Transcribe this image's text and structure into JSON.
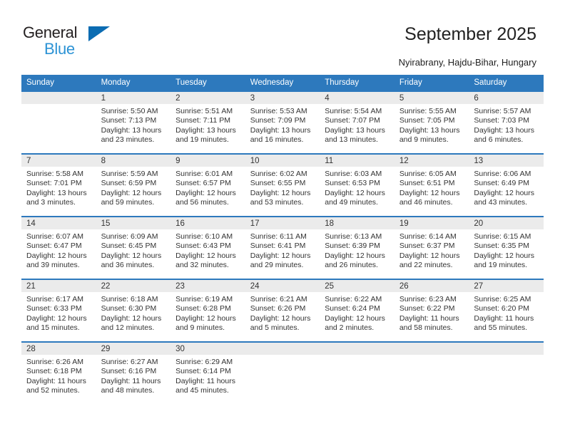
{
  "brand": {
    "name_part1": "General",
    "name_part2": "Blue",
    "triangle_color": "#0b6cb2",
    "blue_color": "#2c93d5"
  },
  "header": {
    "title": "September 2025",
    "subtitle": "Nyirabrany, Hajdu-Bihar, Hungary",
    "accent_color": "#2d79bd"
  },
  "calendar": {
    "weekday_headers": [
      "Sunday",
      "Monday",
      "Tuesday",
      "Wednesday",
      "Thursday",
      "Friday",
      "Saturday"
    ],
    "weeks": [
      [
        {
          "day": "",
          "empty": true,
          "sunrise": "",
          "sunset": "",
          "daylight1": "",
          "daylight2": ""
        },
        {
          "day": "1",
          "sunrise": "Sunrise: 5:50 AM",
          "sunset": "Sunset: 7:13 PM",
          "daylight1": "Daylight: 13 hours",
          "daylight2": "and 23 minutes."
        },
        {
          "day": "2",
          "sunrise": "Sunrise: 5:51 AM",
          "sunset": "Sunset: 7:11 PM",
          "daylight1": "Daylight: 13 hours",
          "daylight2": "and 19 minutes."
        },
        {
          "day": "3",
          "sunrise": "Sunrise: 5:53 AM",
          "sunset": "Sunset: 7:09 PM",
          "daylight1": "Daylight: 13 hours",
          "daylight2": "and 16 minutes."
        },
        {
          "day": "4",
          "sunrise": "Sunrise: 5:54 AM",
          "sunset": "Sunset: 7:07 PM",
          "daylight1": "Daylight: 13 hours",
          "daylight2": "and 13 minutes."
        },
        {
          "day": "5",
          "sunrise": "Sunrise: 5:55 AM",
          "sunset": "Sunset: 7:05 PM",
          "daylight1": "Daylight: 13 hours",
          "daylight2": "and 9 minutes."
        },
        {
          "day": "6",
          "sunrise": "Sunrise: 5:57 AM",
          "sunset": "Sunset: 7:03 PM",
          "daylight1": "Daylight: 13 hours",
          "daylight2": "and 6 minutes."
        }
      ],
      [
        {
          "day": "7",
          "sunrise": "Sunrise: 5:58 AM",
          "sunset": "Sunset: 7:01 PM",
          "daylight1": "Daylight: 13 hours",
          "daylight2": "and 3 minutes."
        },
        {
          "day": "8",
          "sunrise": "Sunrise: 5:59 AM",
          "sunset": "Sunset: 6:59 PM",
          "daylight1": "Daylight: 12 hours",
          "daylight2": "and 59 minutes."
        },
        {
          "day": "9",
          "sunrise": "Sunrise: 6:01 AM",
          "sunset": "Sunset: 6:57 PM",
          "daylight1": "Daylight: 12 hours",
          "daylight2": "and 56 minutes."
        },
        {
          "day": "10",
          "sunrise": "Sunrise: 6:02 AM",
          "sunset": "Sunset: 6:55 PM",
          "daylight1": "Daylight: 12 hours",
          "daylight2": "and 53 minutes."
        },
        {
          "day": "11",
          "sunrise": "Sunrise: 6:03 AM",
          "sunset": "Sunset: 6:53 PM",
          "daylight1": "Daylight: 12 hours",
          "daylight2": "and 49 minutes."
        },
        {
          "day": "12",
          "sunrise": "Sunrise: 6:05 AM",
          "sunset": "Sunset: 6:51 PM",
          "daylight1": "Daylight: 12 hours",
          "daylight2": "and 46 minutes."
        },
        {
          "day": "13",
          "sunrise": "Sunrise: 6:06 AM",
          "sunset": "Sunset: 6:49 PM",
          "daylight1": "Daylight: 12 hours",
          "daylight2": "and 43 minutes."
        }
      ],
      [
        {
          "day": "14",
          "sunrise": "Sunrise: 6:07 AM",
          "sunset": "Sunset: 6:47 PM",
          "daylight1": "Daylight: 12 hours",
          "daylight2": "and 39 minutes."
        },
        {
          "day": "15",
          "sunrise": "Sunrise: 6:09 AM",
          "sunset": "Sunset: 6:45 PM",
          "daylight1": "Daylight: 12 hours",
          "daylight2": "and 36 minutes."
        },
        {
          "day": "16",
          "sunrise": "Sunrise: 6:10 AM",
          "sunset": "Sunset: 6:43 PM",
          "daylight1": "Daylight: 12 hours",
          "daylight2": "and 32 minutes."
        },
        {
          "day": "17",
          "sunrise": "Sunrise: 6:11 AM",
          "sunset": "Sunset: 6:41 PM",
          "daylight1": "Daylight: 12 hours",
          "daylight2": "and 29 minutes."
        },
        {
          "day": "18",
          "sunrise": "Sunrise: 6:13 AM",
          "sunset": "Sunset: 6:39 PM",
          "daylight1": "Daylight: 12 hours",
          "daylight2": "and 26 minutes."
        },
        {
          "day": "19",
          "sunrise": "Sunrise: 6:14 AM",
          "sunset": "Sunset: 6:37 PM",
          "daylight1": "Daylight: 12 hours",
          "daylight2": "and 22 minutes."
        },
        {
          "day": "20",
          "sunrise": "Sunrise: 6:15 AM",
          "sunset": "Sunset: 6:35 PM",
          "daylight1": "Daylight: 12 hours",
          "daylight2": "and 19 minutes."
        }
      ],
      [
        {
          "day": "21",
          "sunrise": "Sunrise: 6:17 AM",
          "sunset": "Sunset: 6:33 PM",
          "daylight1": "Daylight: 12 hours",
          "daylight2": "and 15 minutes."
        },
        {
          "day": "22",
          "sunrise": "Sunrise: 6:18 AM",
          "sunset": "Sunset: 6:30 PM",
          "daylight1": "Daylight: 12 hours",
          "daylight2": "and 12 minutes."
        },
        {
          "day": "23",
          "sunrise": "Sunrise: 6:19 AM",
          "sunset": "Sunset: 6:28 PM",
          "daylight1": "Daylight: 12 hours",
          "daylight2": "and 9 minutes."
        },
        {
          "day": "24",
          "sunrise": "Sunrise: 6:21 AM",
          "sunset": "Sunset: 6:26 PM",
          "daylight1": "Daylight: 12 hours",
          "daylight2": "and 5 minutes."
        },
        {
          "day": "25",
          "sunrise": "Sunrise: 6:22 AM",
          "sunset": "Sunset: 6:24 PM",
          "daylight1": "Daylight: 12 hours",
          "daylight2": "and 2 minutes."
        },
        {
          "day": "26",
          "sunrise": "Sunrise: 6:23 AM",
          "sunset": "Sunset: 6:22 PM",
          "daylight1": "Daylight: 11 hours",
          "daylight2": "and 58 minutes."
        },
        {
          "day": "27",
          "sunrise": "Sunrise: 6:25 AM",
          "sunset": "Sunset: 6:20 PM",
          "daylight1": "Daylight: 11 hours",
          "daylight2": "and 55 minutes."
        }
      ],
      [
        {
          "day": "28",
          "sunrise": "Sunrise: 6:26 AM",
          "sunset": "Sunset: 6:18 PM",
          "daylight1": "Daylight: 11 hours",
          "daylight2": "and 52 minutes."
        },
        {
          "day": "29",
          "sunrise": "Sunrise: 6:27 AM",
          "sunset": "Sunset: 6:16 PM",
          "daylight1": "Daylight: 11 hours",
          "daylight2": "and 48 minutes."
        },
        {
          "day": "30",
          "sunrise": "Sunrise: 6:29 AM",
          "sunset": "Sunset: 6:14 PM",
          "daylight1": "Daylight: 11 hours",
          "daylight2": "and 45 minutes."
        },
        {
          "day": "",
          "empty": true,
          "sunrise": "",
          "sunset": "",
          "daylight1": "",
          "daylight2": ""
        },
        {
          "day": "",
          "empty": true,
          "sunrise": "",
          "sunset": "",
          "daylight1": "",
          "daylight2": ""
        },
        {
          "day": "",
          "empty": true,
          "sunrise": "",
          "sunset": "",
          "daylight1": "",
          "daylight2": ""
        },
        {
          "day": "",
          "empty": true,
          "sunrise": "",
          "sunset": "",
          "daylight1": "",
          "daylight2": ""
        }
      ]
    ]
  }
}
